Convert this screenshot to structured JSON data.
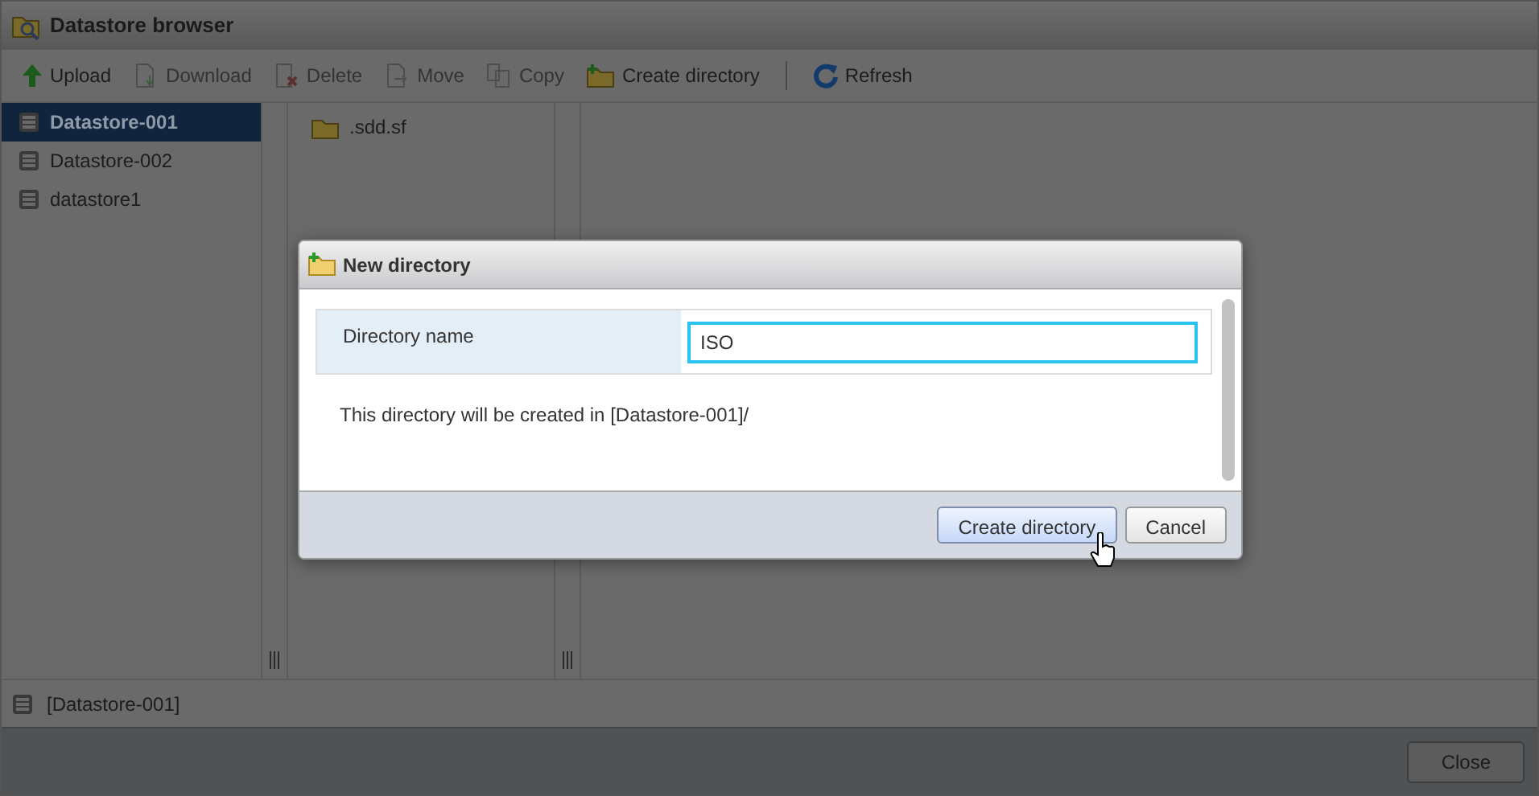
{
  "window": {
    "title": "Datastore browser"
  },
  "toolbar": [
    {
      "kind": "button",
      "label": "Upload",
      "disabled": false
    },
    {
      "kind": "button",
      "label": "Download",
      "disabled": true
    },
    {
      "kind": "button",
      "label": "Delete",
      "disabled": true
    },
    {
      "kind": "button",
      "label": "Move",
      "disabled": true
    },
    {
      "kind": "button",
      "label": "Copy",
      "disabled": true
    },
    {
      "kind": "button",
      "label": "Create directory",
      "disabled": false
    },
    {
      "kind": "separator"
    },
    {
      "kind": "button",
      "label": "Refresh",
      "disabled": false
    }
  ],
  "datastores": [
    {
      "label": "Datastore-001",
      "selected": true
    },
    {
      "label": "Datastore-002",
      "selected": false
    },
    {
      "label": "datastore1",
      "selected": false
    }
  ],
  "files": [
    {
      "label": ".sdd.sf"
    }
  ],
  "status_bar": {
    "path": "[Datastore-001]"
  },
  "footer_buttons": [
    "Close"
  ],
  "dialog": {
    "title": "New directory",
    "field": {
      "label": "Directory name",
      "value": "ISO",
      "focused": true
    },
    "message": "This directory will be created in [Datastore-001]/",
    "buttons": [
      {
        "label": "Create directory",
        "hovered": true
      },
      {
        "label": "Cancel",
        "hovered": false
      }
    ]
  }
}
